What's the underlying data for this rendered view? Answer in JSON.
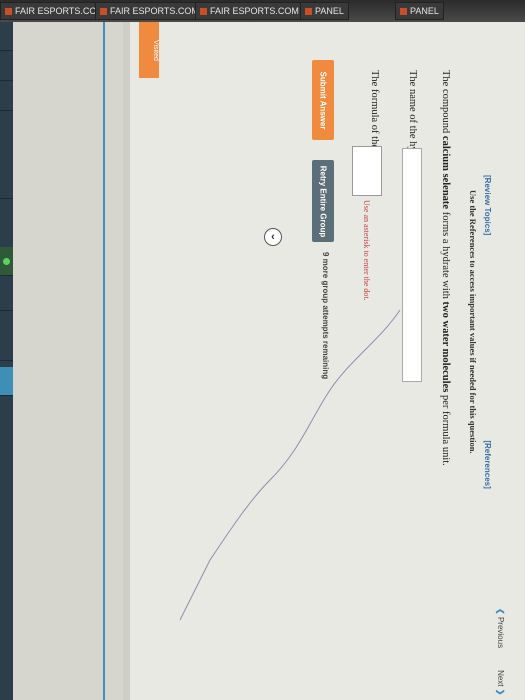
{
  "tabs": [
    {
      "label": "FAIR ESPORTS.COM"
    },
    {
      "label": "FAIR ESPORTS.COM"
    },
    {
      "label": "FAIR ESPORTS.COM"
    },
    {
      "label": "PANEL"
    },
    {
      "label": "PANEL"
    }
  ],
  "sidebar": {
    "items": [
      "",
      "",
      "",
      "",
      "",
      "",
      "",
      ""
    ]
  },
  "header": {
    "review_topics": "[Review Topics]",
    "references": "[References]",
    "reference_note": "Use the References to access important values if needed for this question."
  },
  "question": {
    "prefix": "The compound ",
    "compound": "calcium selenate",
    "middle": " forms a hydrate with ",
    "water": "two water molecules",
    "suffix": " per formula unit."
  },
  "fields": {
    "name_label": "The name of the hydrate is:",
    "name_value": "",
    "formula_label": "The formula of the hydrate is:",
    "formula_value": "",
    "hint": "Use an asterisk to enter the dot."
  },
  "buttons": {
    "submit": "Submit Answer",
    "retry": "Retry Entire Group",
    "remaining": "9 more group attempts remaining"
  },
  "nav": {
    "previous": "Previous",
    "next": "Next",
    "orange_tab": "Visited"
  },
  "colors": {
    "accent_orange": "#f08a3e",
    "retry_gray": "#5c6e78",
    "link_blue": "#3a6fa5",
    "hint_red": "#c2453d"
  }
}
